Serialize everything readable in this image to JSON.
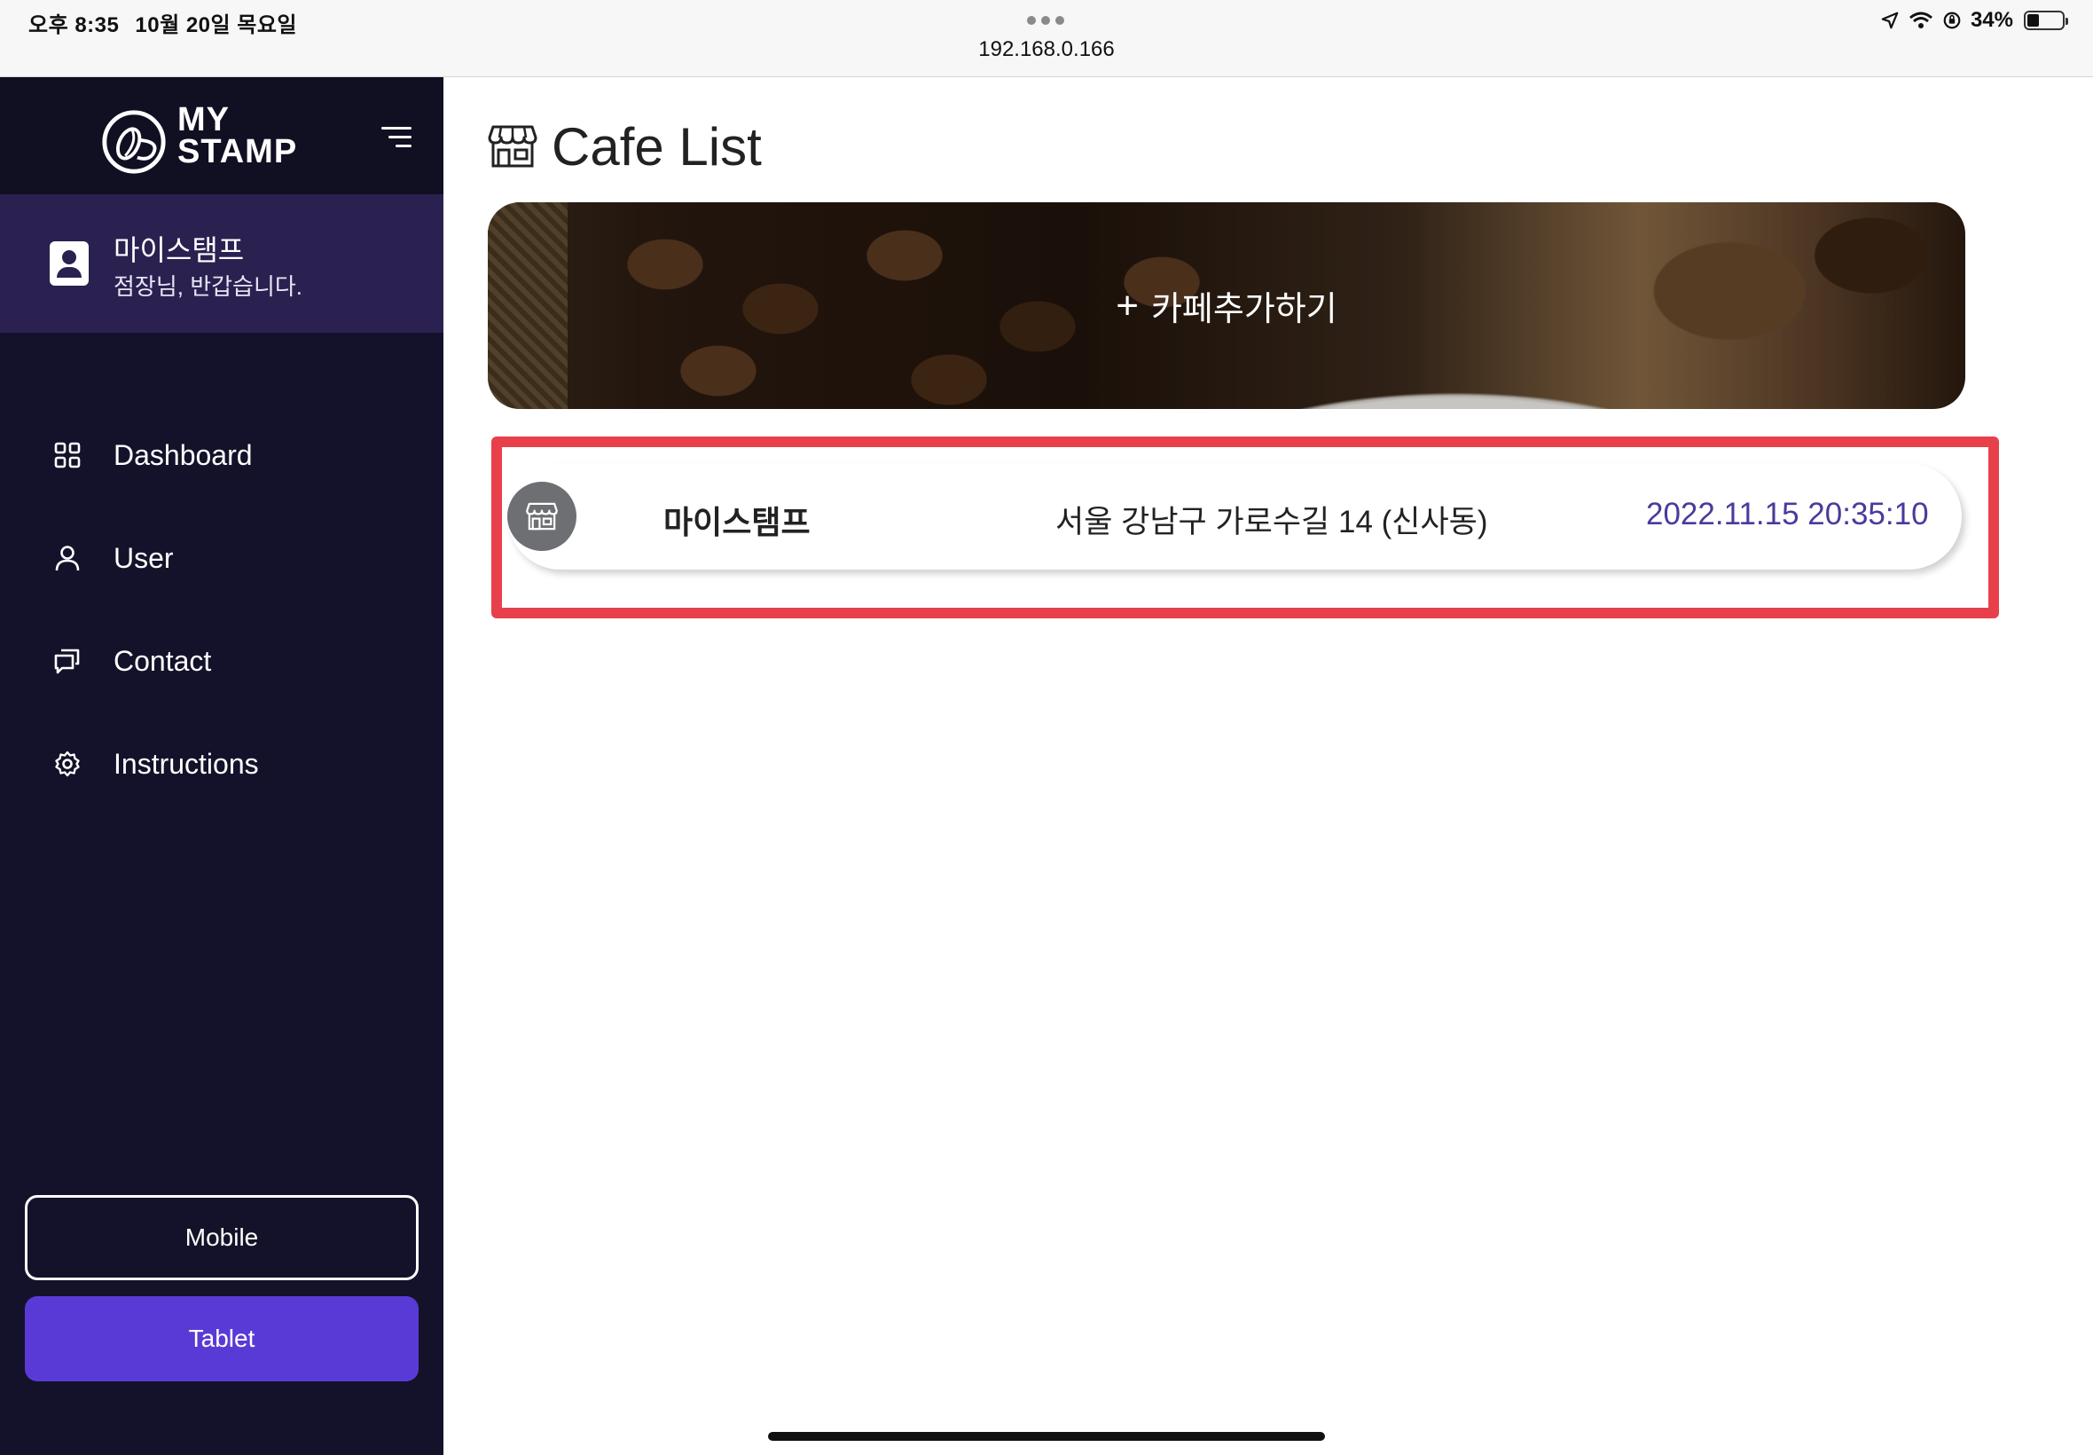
{
  "status_bar": {
    "time": "오후 8:35",
    "date": "10월 20일 목요일",
    "url": "192.168.0.166",
    "battery": "34%",
    "battery_level": 0.34
  },
  "sidebar": {
    "brand_line1": "MY",
    "brand_line2": "STAMP",
    "profile": {
      "name": "마이스탬프",
      "greeting": "점장님, 반갑습니다."
    },
    "nav": [
      {
        "label": "Dashboard",
        "icon": "grid-icon"
      },
      {
        "label": "User",
        "icon": "user-icon"
      },
      {
        "label": "Contact",
        "icon": "chat-icon"
      },
      {
        "label": "Instructions",
        "icon": "gear-icon"
      }
    ],
    "mobile_button": "Mobile",
    "tablet_button": "Tablet"
  },
  "main": {
    "title": "Cafe List",
    "add_cafe": "카페추가하기",
    "cafes": [
      {
        "name": "마이스탬프",
        "address": "서울 강남구 가로수길 14 (신사동)",
        "created": "2022.11.15 20:35:10"
      }
    ]
  },
  "colors": {
    "sidebar_bg": "#14122a",
    "profile_bg": "#2a2150",
    "accent": "#5a3ad6",
    "date_text": "#4a3a9c",
    "highlight": "#e8404b"
  }
}
